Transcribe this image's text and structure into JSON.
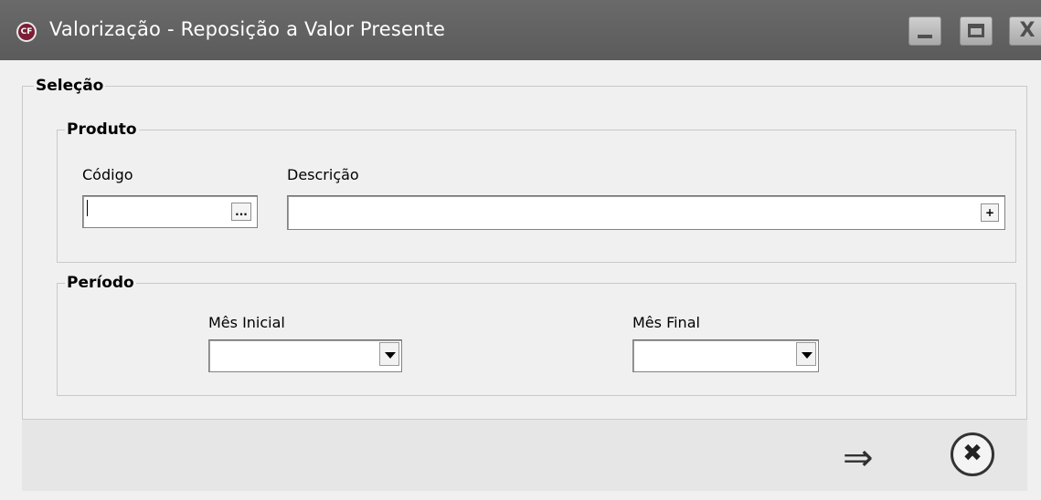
{
  "window": {
    "title": "Valorização - Reposição a Valor Presente",
    "app_icon_text": "CF",
    "controls": {
      "minimize": "minimize-icon",
      "maximize": "maximize-icon",
      "close": "X"
    }
  },
  "selecao": {
    "label": "Seleção",
    "produto": {
      "label": "Produto",
      "codigo_label": "Código",
      "codigo_value": "",
      "codigo_button": "...",
      "descricao_label": "Descrição",
      "descricao_value": "",
      "descricao_button": "+"
    },
    "periodo": {
      "label": "Período",
      "mes_inicial_label": "Mês Inicial",
      "mes_inicial_value": "",
      "mes_final_label": "Mês Final",
      "mes_final_value": ""
    }
  },
  "footer": {
    "confirm_icon": "⇒",
    "cancel_icon": "✖"
  }
}
